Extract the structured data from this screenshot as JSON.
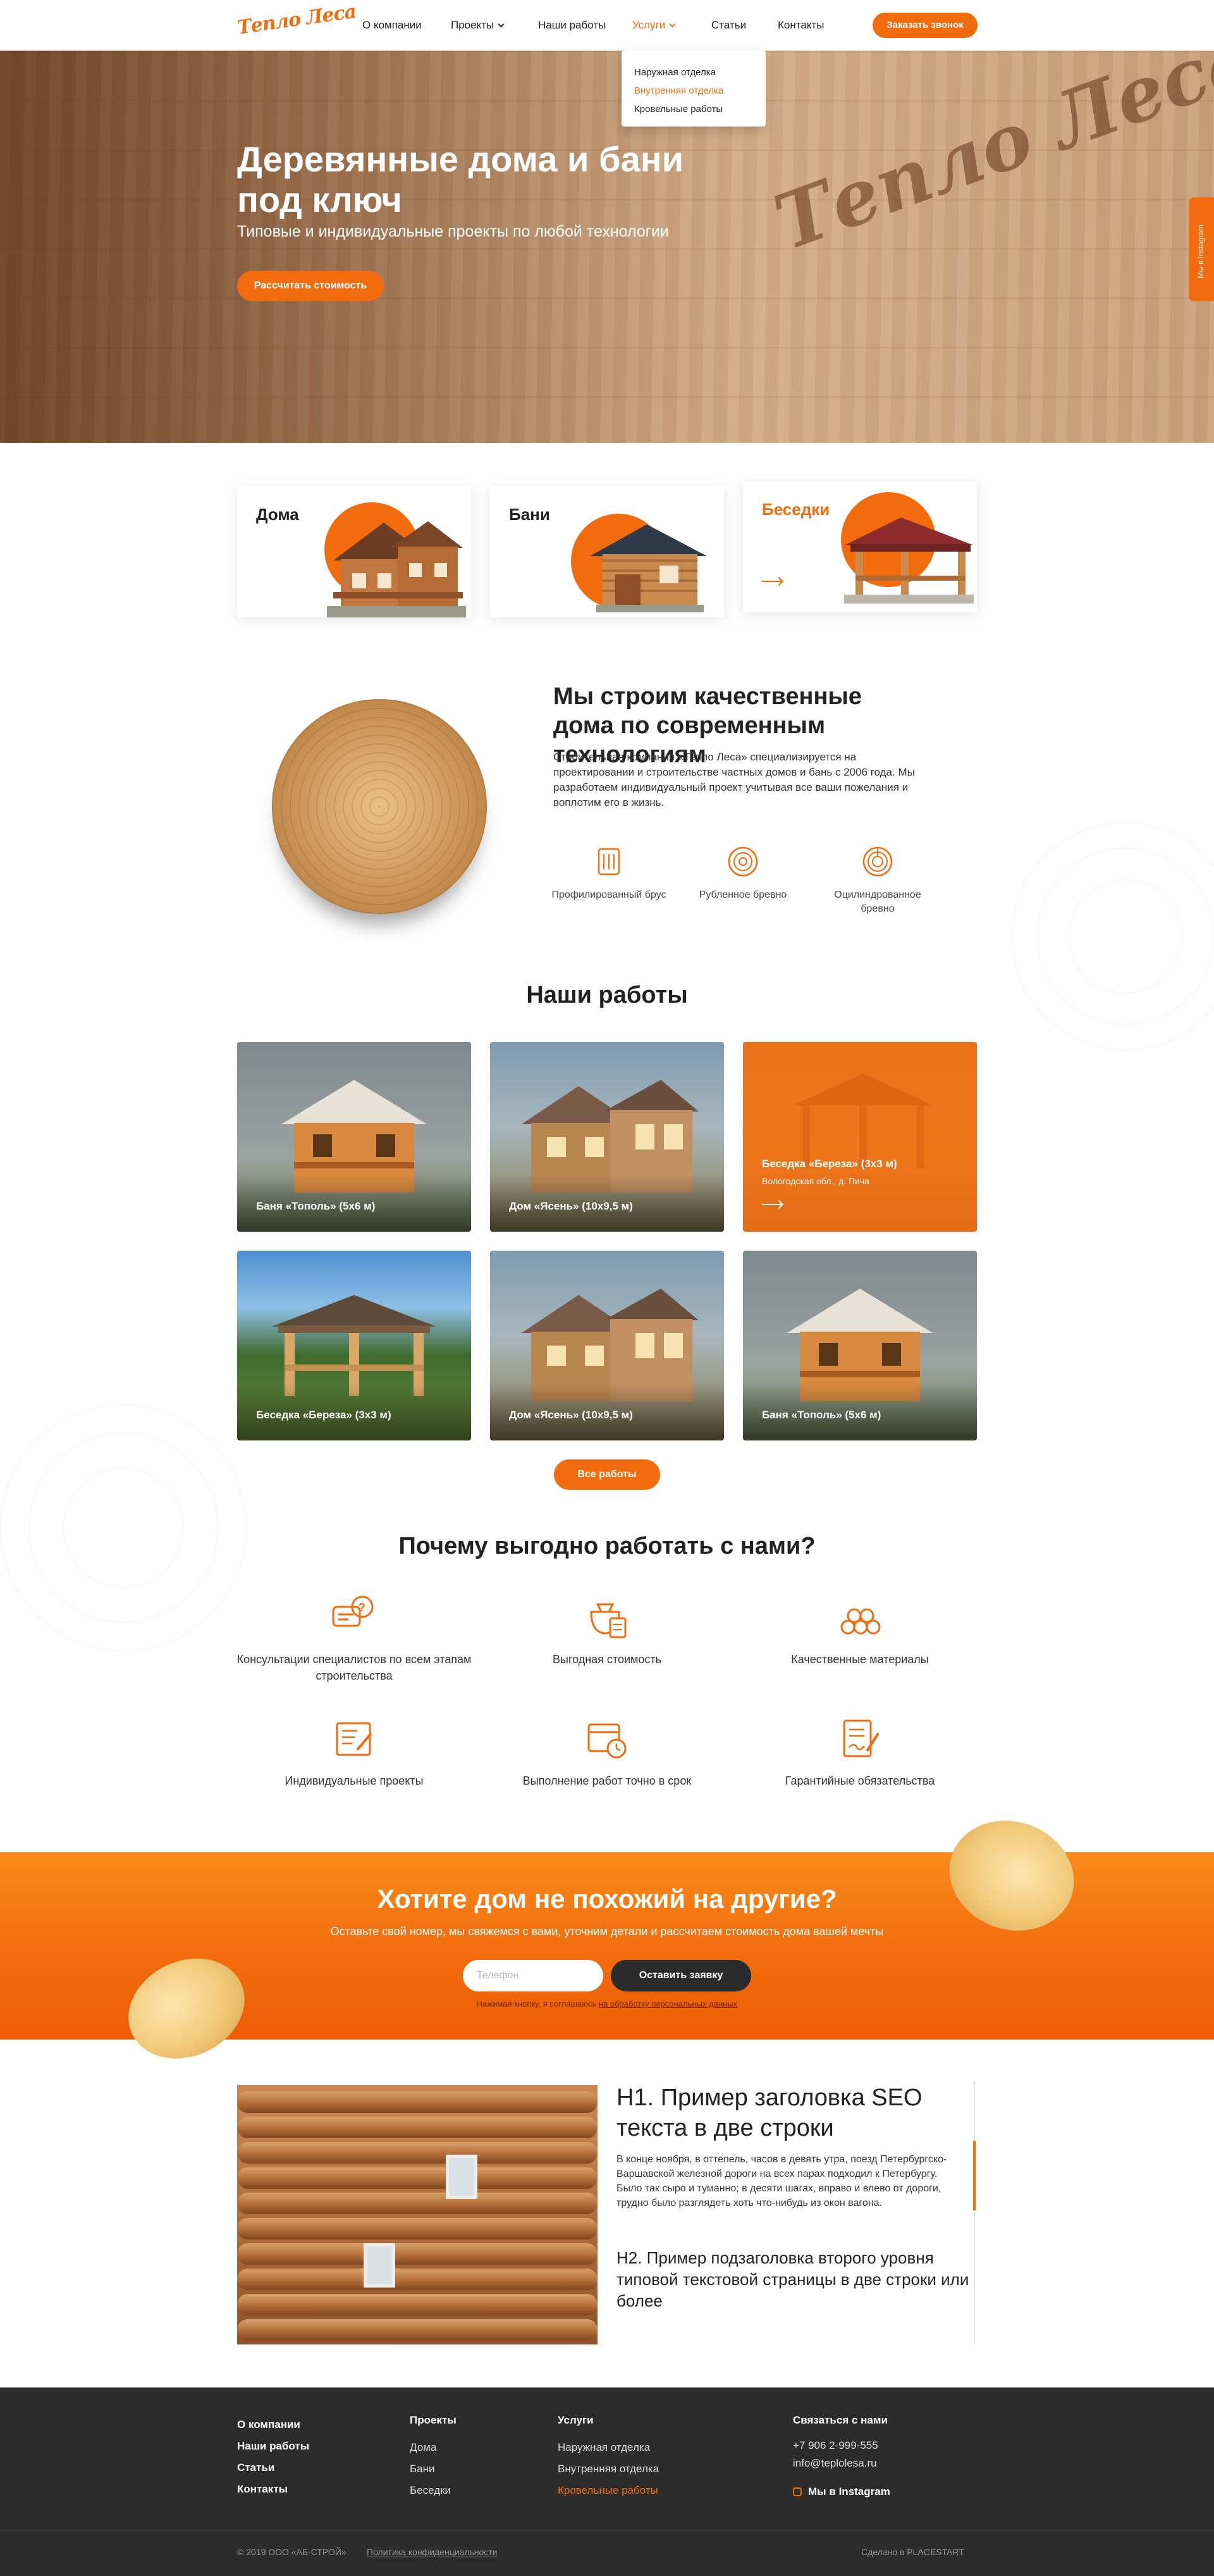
{
  "header": {
    "logo": "Тепло Леса",
    "nav": [
      "О компании",
      "Проекты",
      "Наши работы",
      "Услуги",
      "Статьи",
      "Контакты"
    ],
    "call_button": "Заказать звонок"
  },
  "services_dropdown": {
    "items": [
      "Наружная отделка",
      "Внутренняя отделка",
      "Кровельные работы"
    ],
    "hovered": "Внутренняя отделка"
  },
  "hero": {
    "title": "Деревянные дома и бани под ключ",
    "subtitle": "Типовые и индивидуальные проекты по любой технологии",
    "button": "Рассчитать стоимость",
    "stamp": "Тепло Леса"
  },
  "instagram_tab": "Мы в Instagram",
  "categories": [
    {
      "label": "Дома",
      "active": false
    },
    {
      "label": "Бани",
      "active": false
    },
    {
      "label": "Беседки",
      "active": true
    }
  ],
  "about": {
    "title": "Мы строим качественные дома по современным технологиям",
    "text": "Строительная компания «Тепло Леса» специализируется на проектировании и строительстве частных домов и бань с 2006 года. Мы разработаем индивидуальный проект учитывая все ваши пожелания и воплотим его в жизнь.",
    "technologies": [
      "Профилированный брус",
      "Рубленное бревно",
      "Оцилиндрованное бревно"
    ]
  },
  "works": {
    "title": "Наши работы",
    "items": [
      {
        "caption": "Баня «Тополь» (5х6 м)",
        "location": ""
      },
      {
        "caption": "Дом «Ясень» (10х9,5 м)",
        "location": ""
      },
      {
        "caption": "Беседка «Береза» (3х3 м)",
        "location": "Вологодская обл., д. Пича"
      },
      {
        "caption": "Беседка «Береза» (3х3 м)",
        "location": ""
      },
      {
        "caption": "Дом «Ясень» (10х9,5 м)",
        "location": ""
      },
      {
        "caption": "Баня «Тополь» (5х6 м)",
        "location": ""
      }
    ],
    "button": "Все работы"
  },
  "why": {
    "title": "Почему выгодно работать с нами?",
    "items": [
      {
        "text": "Консультации специалистов по всем этапам строительства",
        "icon": "chat-icon"
      },
      {
        "text": "Выгодная стоимость",
        "icon": "money-calculator-icon"
      },
      {
        "text": "Качественные материалы",
        "icon": "logs-icon"
      },
      {
        "text": "Индивидуальные проекты",
        "icon": "blueprint-icon"
      },
      {
        "text": "Выполнение работ точно в срок",
        "icon": "calendar-clock-icon"
      },
      {
        "text": "Гарантийные обязательства",
        "icon": "contract-icon"
      }
    ]
  },
  "cta": {
    "title": "Хотите дом не похожий на другие?",
    "subtitle": "Оставьте свой номер, мы свяжемся с вами, уточним детали и рассчитаем стоимость дома вашей мечты",
    "phone_placeholder": "Телефон",
    "phone_value": "",
    "button": "Оставить заявку",
    "consent_text": "Нажимая кнопку, я соглашаюсь",
    "consent_link": "на обработку персональных данных"
  },
  "article": {
    "h1": "H1. Пример заголовка SEO текста в две строки",
    "paragraph": "В конце ноября, в оттепель, часов в девять утра, поезд Петербургско-Варшавской железной дороги на всех парах подходил к Петербургу. Было так сыро и туманно; в десяти шагах, вправо и влево от дороги, трудно было разглядеть хоть что-нибудь из окон вагона.",
    "h2": "H2. Пример подзаголовка второго уровня типовой текстовой страницы в две строки или более"
  },
  "footer": {
    "col1": [
      "О компании",
      "Наши работы",
      "Статьи",
      "Контакты"
    ],
    "col2_title": "Проекты",
    "col2": [
      "Дома",
      "Бани",
      "Беседки"
    ],
    "col3_title": "Услуги",
    "col3": [
      "Наружная отделка",
      "Внутренняя отделка",
      "Кровельные работы"
    ],
    "col4_title": "Связаться с нами",
    "phone": "+7 906 2-999-555",
    "email": "info@teplolesa.ru",
    "instagram": "Мы в Instagram",
    "copyright": "© 2019 ООО «АБ-СТРОЙ»",
    "privacy": "Политика конфиденциальности",
    "made_by": "Сделано в PLACESTART"
  },
  "colors": {
    "accent": "#f26c0d",
    "dark": "#2c2c2c",
    "text": "#222222"
  }
}
